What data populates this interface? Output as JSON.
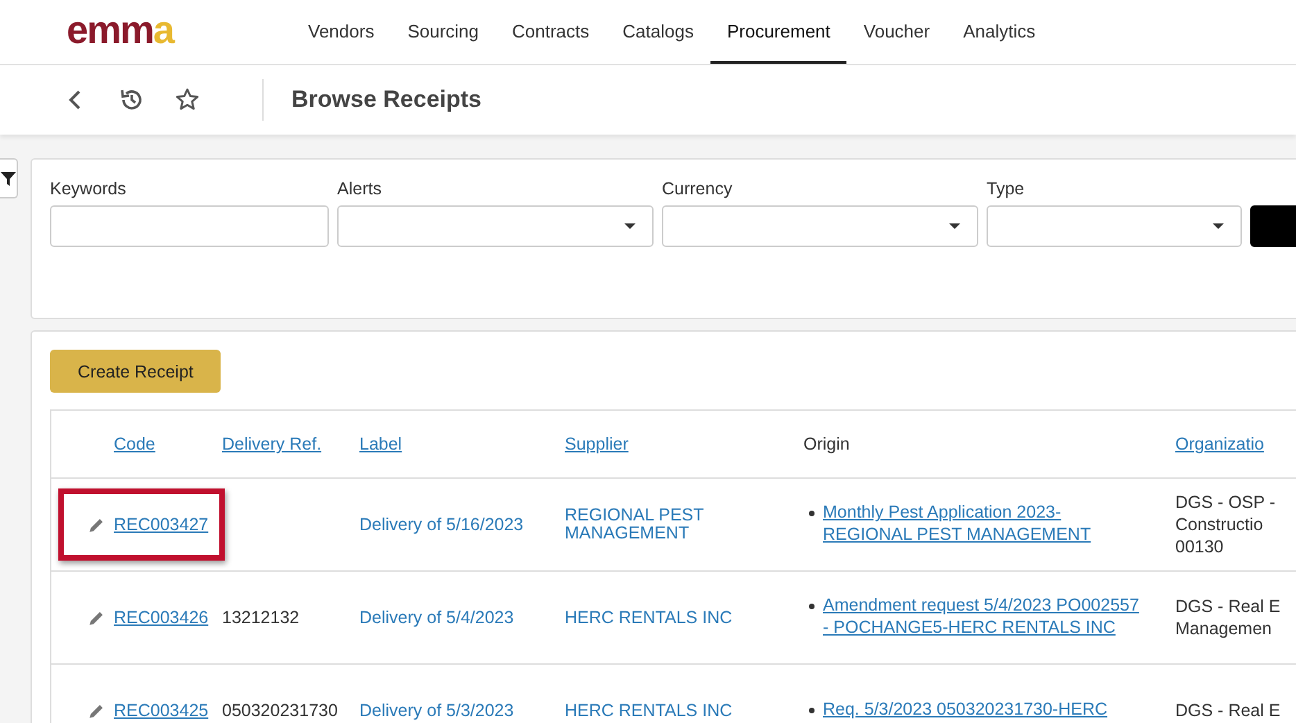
{
  "logo": [
    {
      "text": "emm",
      "color": "#8b1a2b"
    },
    {
      "text": "a",
      "color": "#e8b931"
    }
  ],
  "nav": [
    {
      "label": "Vendors",
      "selected": false
    },
    {
      "label": "Sourcing",
      "selected": false
    },
    {
      "label": "Contracts",
      "selected": false
    },
    {
      "label": "Catalogs",
      "selected": false
    },
    {
      "label": "Procurement",
      "selected": true
    },
    {
      "label": "Voucher",
      "selected": false
    },
    {
      "label": "Analytics",
      "selected": false
    }
  ],
  "page_title": "Browse Receipts",
  "filters": [
    {
      "label": "Keywords",
      "kind": "text"
    },
    {
      "label": "Alerts",
      "kind": "select"
    },
    {
      "label": "Currency",
      "kind": "select"
    },
    {
      "label": "Type",
      "kind": "select"
    }
  ],
  "create_button": "Create Receipt",
  "table": {
    "columns": [
      {
        "label": "Code",
        "sortable": true
      },
      {
        "label": "Delivery Ref.",
        "sortable": true
      },
      {
        "label": "Label",
        "sortable": true
      },
      {
        "label": "Supplier",
        "sortable": true
      },
      {
        "label": "Origin",
        "sortable": false
      },
      {
        "label": "Organizatio",
        "sortable": true
      }
    ],
    "rows": [
      {
        "code": "REC003427",
        "delivery_ref": "",
        "label": "Delivery of 5/16/2023",
        "supplier": "REGIONAL PEST MANAGEMENT",
        "origin": [
          "Monthly Pest Application 2023-",
          "REGIONAL PEST MANAGEMENT"
        ],
        "organization": [
          "DGS - OSP -",
          "Constructio",
          "00130"
        ],
        "highlighted": true
      },
      {
        "code": "REC003426",
        "delivery_ref": "13212132",
        "label": "Delivery of 5/4/2023",
        "supplier": "HERC RENTALS INC",
        "origin": [
          "Amendment request 5/4/2023 PO002557",
          "- POCHANGE5-HERC RENTALS INC"
        ],
        "organization": [
          "DGS - Real E",
          "Managemen"
        ],
        "highlighted": false
      },
      {
        "code": "REC003425",
        "delivery_ref": "050320231730",
        "label": "Delivery of 5/3/2023",
        "supplier": "HERC RENTALS INC",
        "origin": [
          "Req. 5/3/2023 050320231730-HERC"
        ],
        "organization": [
          "DGS - Real E"
        ],
        "highlighted": false
      }
    ]
  }
}
